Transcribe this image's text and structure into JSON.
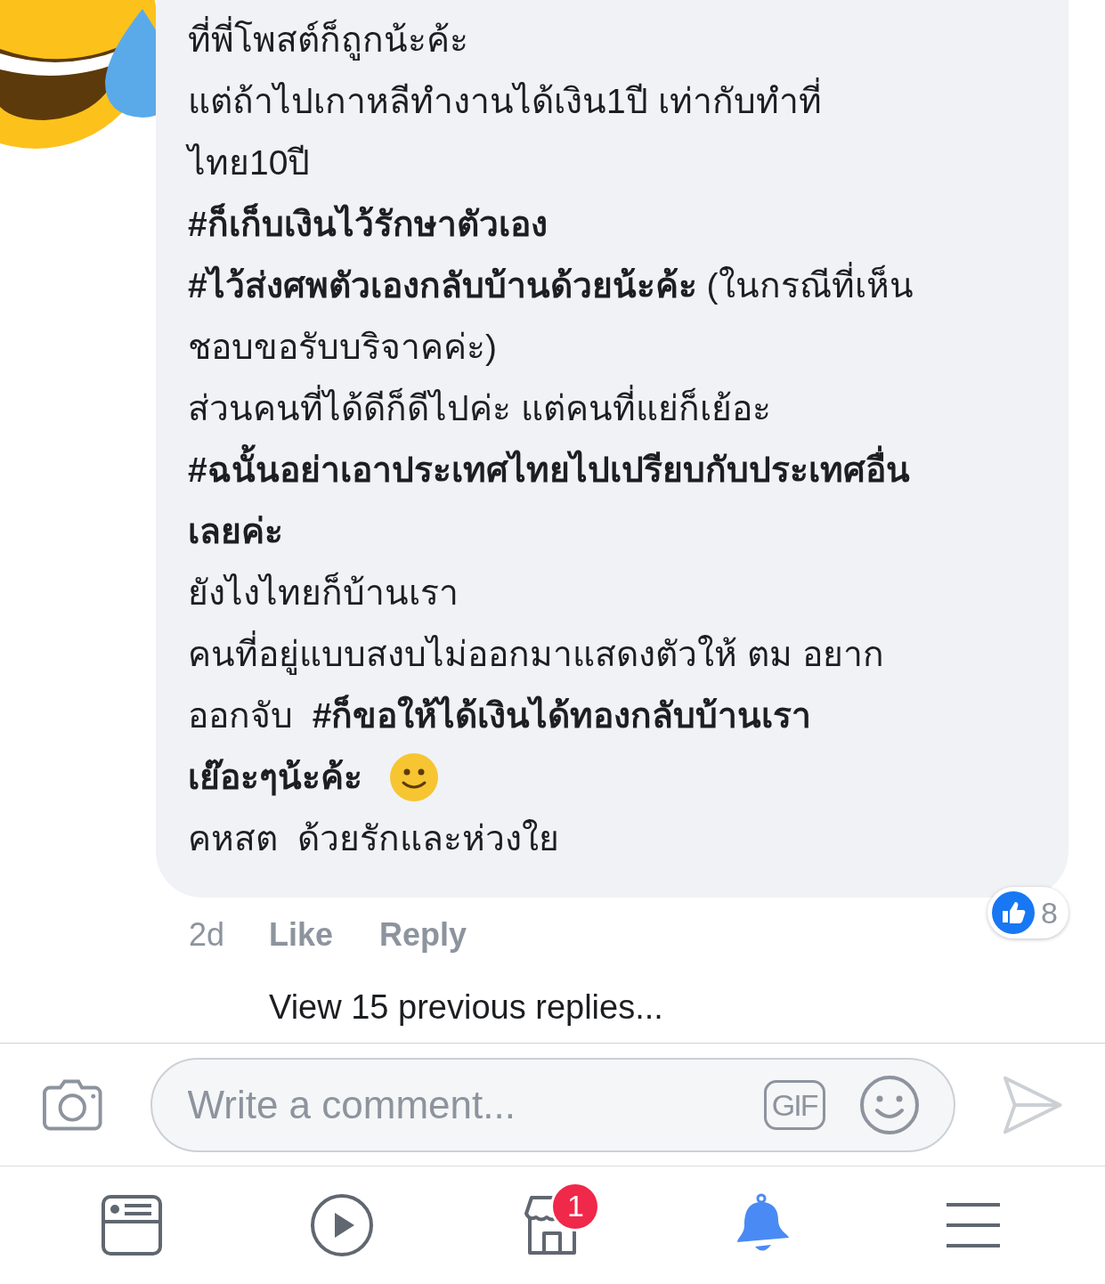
{
  "comment": {
    "lines": [
      {
        "text": "ที่พี่โพสต์ก็ถูกน้ะค้ะ",
        "bold": false
      },
      {
        "text": "แต่ถ้าไปเกาหลีทำงานได้เงิน1ปี เท่ากับทำที่",
        "bold": false
      },
      {
        "text": "ไทย10ปี",
        "bold": false
      },
      {
        "text": "#ก็เก็บเงินไว้รักษาตัวเอง",
        "bold": true
      },
      {
        "text": "**#ไว้ส่งศพตัวเองกลับบ้านด้วยน้ะค้ะ** (ในกรณีที่เห็น",
        "bold": false
      },
      {
        "text": "ชอบขอรับบริจาคค่ะ)",
        "bold": false
      },
      {
        "text": "ส่วนคนที่ได้ดีก็ดีไปค่ะ แต่คนที่แย่ก็เย้อะ",
        "bold": false
      },
      {
        "text": "#ฉนั้นอย่าเอาประเทศไทยไปเปรียบกับประเทศอื่น",
        "bold": true
      },
      {
        "text": "เลยค่ะ",
        "bold": true
      },
      {
        "text": "ยังไงไทยก็บ้านเรา",
        "bold": false
      },
      {
        "text": "คนที่อยู่แบบสงบไม่ออกมาแสดงตัวให้ ตม อยาก",
        "bold": false
      },
      {
        "text": "ออกจับ  **#ก็ขอให้ได้เงินได้ทองกลับบ้านเรา**",
        "bold": false
      },
      {
        "text": "เย๊อะๆน้ะค้ะ",
        "bold": true,
        "emoji": true
      },
      {
        "text": "คหสต  ด้วยรักและห่วงใย",
        "bold": false
      }
    ],
    "time": "2d",
    "actions": [
      "Like",
      "Reply"
    ],
    "reactions": {
      "count": "8"
    }
  },
  "view_previous": "View 15 previous replies...",
  "composer": {
    "placeholder": "Write a comment...",
    "gif": "GIF"
  },
  "tabs": [
    {
      "kind": "feed",
      "selected": false
    },
    {
      "kind": "video",
      "selected": false
    },
    {
      "kind": "marketplace",
      "selected": false,
      "badge": "1"
    },
    {
      "kind": "notifications",
      "selected": true
    },
    {
      "kind": "menu",
      "selected": false
    }
  ]
}
